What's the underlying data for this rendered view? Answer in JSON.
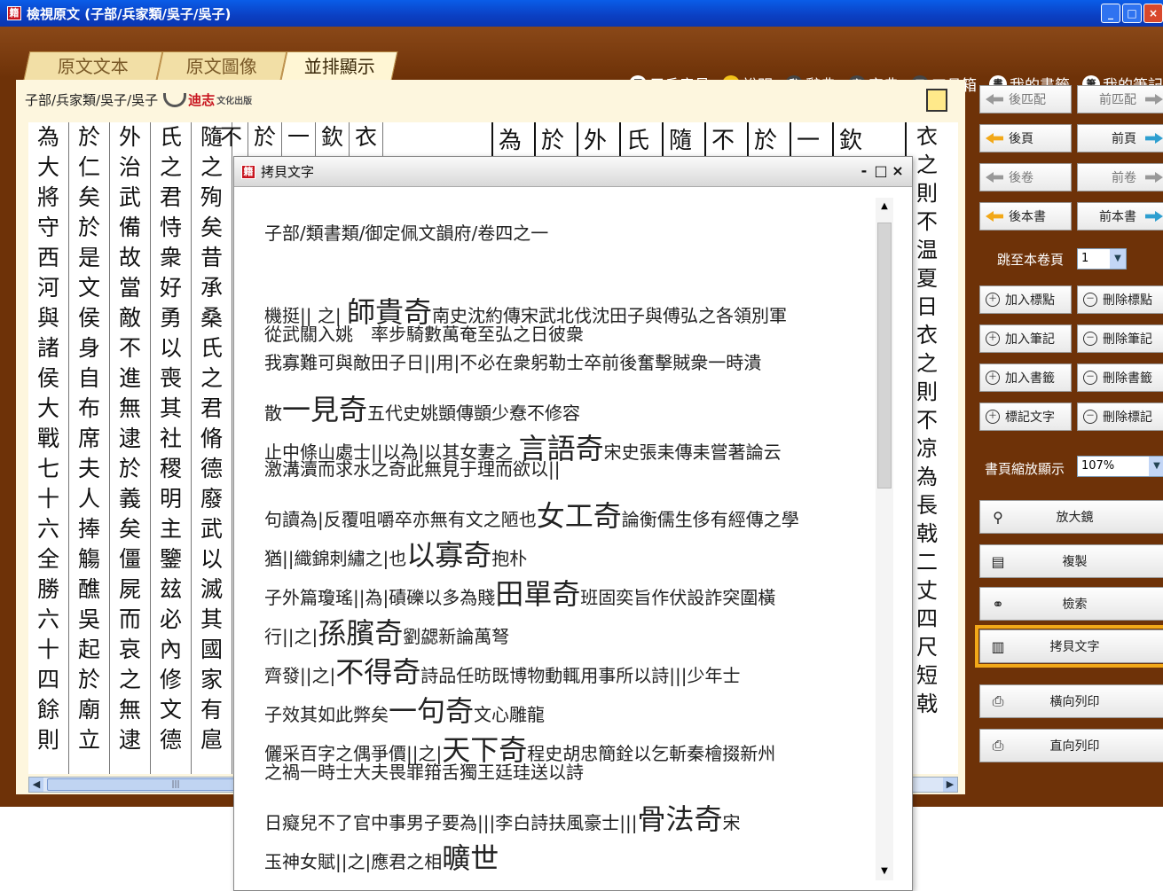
{
  "window": {
    "title": "檢視原文 (子部/兵家類/吳子/吳子)",
    "controls": [
      "_",
      "□",
      "×"
    ]
  },
  "tabs": [
    {
      "label": "原文文本"
    },
    {
      "label": "原文圖像"
    },
    {
      "label": "並排顯示"
    }
  ],
  "toplinks": [
    {
      "label": "用戶意見",
      "icon": "feedback-icon"
    },
    {
      "label": "說明",
      "icon": "help-icon"
    },
    {
      "label": "辭典",
      "icon": "dict-icon"
    },
    {
      "label": "字典",
      "icon": "char-dict-icon"
    },
    {
      "label": "工具箱",
      "icon": "toolbox-icon"
    },
    {
      "label": "我的書籤",
      "icon": "bookmark-icon"
    },
    {
      "label": "我的筆記",
      "icon": "notes-icon"
    }
  ],
  "breadcrumb": "子部/兵家類/吳子/吳子",
  "logo": {
    "brand": "迪志",
    "sub": "文化出版"
  },
  "columns": [
    [
      "為",
      "大",
      "將",
      "守",
      "西",
      "河",
      "與",
      "諸",
      "侯",
      "大",
      "戰",
      "七",
      "十",
      "六",
      "全",
      "勝",
      "六",
      "十",
      "四",
      "餘",
      "則"
    ],
    [
      "於",
      "仁",
      "矣",
      "於",
      "是",
      "文",
      "侯",
      "身",
      "自",
      "布",
      "席",
      "夫",
      "人",
      "捧",
      "觴",
      "醮",
      "吳",
      "起",
      "於",
      "廟",
      "立"
    ],
    [
      "外",
      "治",
      "武",
      "備",
      "故",
      "當",
      "敵",
      "不",
      "進",
      "無",
      "逮",
      "於",
      "義",
      "矣",
      "僵",
      "屍",
      "而",
      "哀",
      "之",
      "無",
      "逮"
    ],
    [
      "氏",
      "之",
      "君",
      "恃",
      "衆",
      "好",
      "勇",
      "以",
      "喪",
      "其",
      "社",
      "稷",
      "明",
      "主",
      "鑒",
      "玆",
      "必",
      "內",
      "修",
      "文",
      "德"
    ],
    [
      "隨",
      "之",
      "殉",
      "矣",
      "昔",
      "承",
      "桑",
      "氏",
      "之",
      "君",
      "脩",
      "德",
      "廢",
      "武",
      "以",
      "滅",
      "其",
      "國",
      "家",
      "有",
      "扈"
    ],
    [
      "不"
    ],
    [
      "於"
    ],
    [
      "一"
    ],
    [
      "欽"
    ],
    [
      "衣"
    ]
  ],
  "scan": {
    "top": [
      "為",
      "於",
      "外",
      "氏",
      "隨",
      "不",
      "於",
      "一",
      "欽"
    ],
    "right": [
      "衣",
      "之",
      "則",
      "不",
      "温",
      "夏",
      "日",
      "衣",
      "之",
      "則",
      "不",
      "凉",
      "為",
      "長",
      "戟",
      "二",
      "丈",
      "四",
      "尺",
      "短",
      "戟"
    ]
  },
  "right_panel": {
    "nav": [
      {
        "left": "後匹配",
        "right": "前匹配"
      },
      {
        "left": "後頁",
        "right": "前頁"
      },
      {
        "left": "後卷",
        "right": "前卷"
      },
      {
        "left": "後本書",
        "right": "前本書"
      }
    ],
    "jump_label": "跳至本卷頁",
    "jump_value": "1",
    "actions": [
      {
        "left": "加入標點",
        "right": "刪除標點"
      },
      {
        "left": "加入筆記",
        "right": "刪除筆記"
      },
      {
        "left": "加入書籤",
        "right": "刪除書籤"
      },
      {
        "left": "標記文字",
        "right": "刪除標記"
      }
    ],
    "zoom_label": "書頁縮放顯示",
    "zoom_value": "107%",
    "tools": [
      {
        "label": "放大鏡"
      },
      {
        "label": "複製"
      },
      {
        "label": "檢索"
      },
      {
        "label": "拷貝文字"
      },
      {
        "label": "橫向列印"
      },
      {
        "label": "直向列印"
      }
    ]
  },
  "dialog": {
    "title": "拷貝文字",
    "lines": [
      "子部/類書類/御定佩文韻府/卷四之一",
      "機挺|| 之| 師貴奇南史沈約傳宋武北伐沈田子與傅弘之各領別軍",
      "從武關入姚　率步騎數萬奄至弘之日彼衆",
      "我寡難可與敵田子日||用|不必在衆躬勒士卒前後奮擊賊衆一時潰",
      "散一見奇五代史姚顗傳顗少憃不修容",
      "止中條山處士||以為|以其女妻之 言語奇宋史張耒傳耒嘗著論云",
      "激溝瀆而求水之奇此無見于理而欲以||",
      "句讀為|反覆咀嚼卒亦無有文之陋也女工奇論衡儒生侈有經傳之學",
      "猶||織錦刺繡之|也以寡奇抱朴",
      "子外篇瓊瑤||為|磧礫以多為賤田單奇班固奕旨作伏設詐突圍橫",
      "行||之|孫臏奇劉勰新論萬弩",
      "齊發||之|不得奇詩品任昉既博物動輒用事所以詩|||少年士",
      "子效其如此弊矣一句奇文心雕龍",
      "儷采百字之偶爭價||之|天下奇程史胡忠簡銓以乞斬秦檜掇新州",
      "之禍一時士大夫畏罪箝舌獨王廷珪送以詩",
      "日癡兒不了官中事男子要為|||李白詩扶風豪士|||骨法奇宋",
      "玉神女賦||之|應君之相曠世"
    ]
  }
}
